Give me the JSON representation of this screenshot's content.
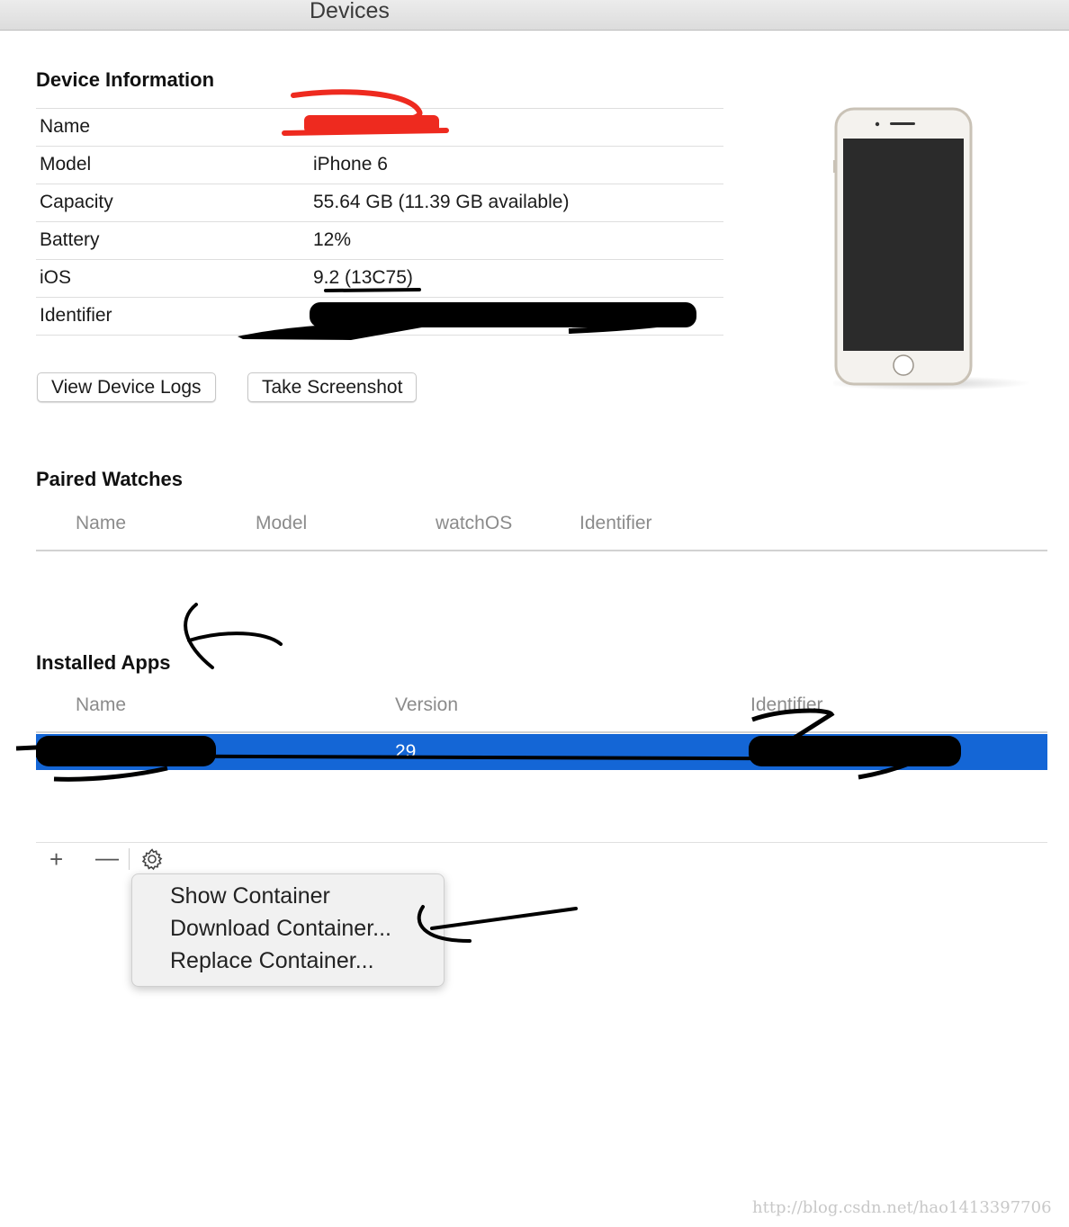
{
  "window": {
    "title": "Devices"
  },
  "device_info": {
    "heading": "Device Information",
    "rows": [
      {
        "label": "Name",
        "value": ""
      },
      {
        "label": "Model",
        "value": "iPhone 6"
      },
      {
        "label": "Capacity",
        "value": "55.64 GB (11.39 GB available)"
      },
      {
        "label": "Battery",
        "value": "12%"
      },
      {
        "label": "iOS",
        "value": "9.2 (13C75)"
      },
      {
        "label": "Identifier",
        "value": ""
      }
    ],
    "buttons": {
      "view_logs": "View Device Logs",
      "screenshot": "Take Screenshot"
    }
  },
  "paired_watches": {
    "heading": "Paired Watches",
    "columns": [
      "Name",
      "Model",
      "watchOS",
      "Identifier"
    ]
  },
  "installed_apps": {
    "heading": "Installed Apps",
    "columns": [
      "Name",
      "Version",
      "Identifier"
    ],
    "rows": [
      {
        "name": "",
        "version": "29",
        "identifier": ""
      }
    ],
    "selected_color": "#1466d6"
  },
  "toolbar": {
    "add": "+",
    "remove": "—",
    "gear_icon": "gear-icon"
  },
  "context_menu": {
    "items": [
      "Show Container",
      "Download Container...",
      "Replace Container..."
    ]
  },
  "watermark": "http://blog.csdn.net/hao1413397706",
  "colors": {
    "selection": "#1466d6",
    "red_annotation": "#ee2a1f",
    "ink": "#000000"
  }
}
